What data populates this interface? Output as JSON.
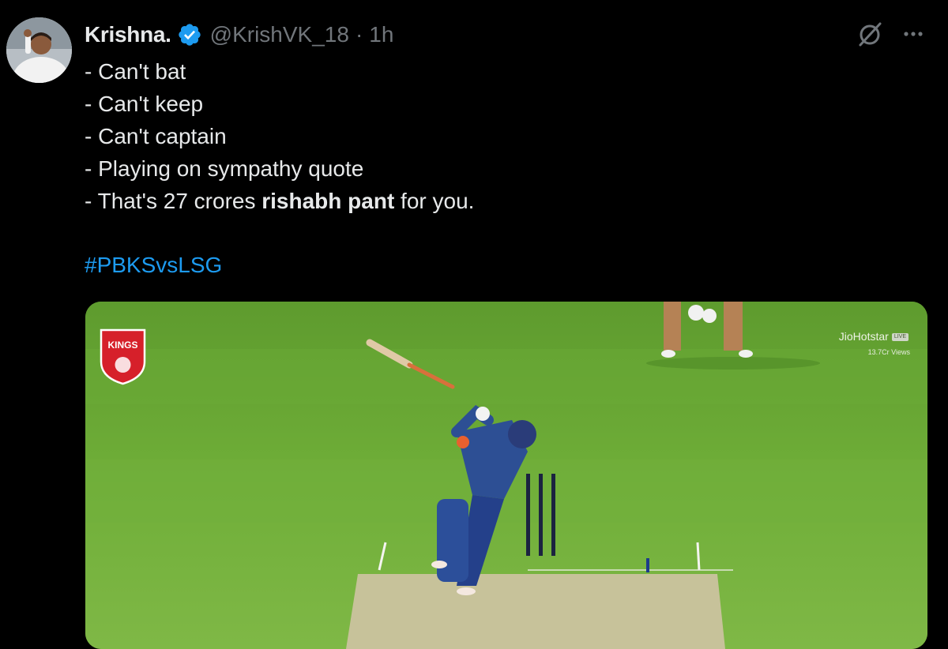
{
  "tweet": {
    "author": {
      "name": "Krishna.",
      "handle": "@KrishVK_18",
      "separator": "·",
      "time": "1h",
      "avatar_alt": "avatar"
    },
    "lines": [
      "- Can't bat",
      "- Can't keep",
      "- Can't captain",
      "- Playing on sympathy quote"
    ],
    "last_line": {
      "prefix": "- That's 27 crores ",
      "bold": "rishabh pant",
      "suffix": " for you."
    },
    "hashtag": "#PBKSvsLSG"
  },
  "media": {
    "logo_text": "KINGS",
    "watermark": "JioHotstar",
    "live_badge": "LIVE",
    "views": "13.7Cr Views"
  },
  "colors": {
    "background": "#000000",
    "text": "#e7e9ea",
    "muted": "#71767b",
    "link": "#1d9bf0",
    "verified": "#1d9bf0",
    "pitch_green": "#69a836"
  },
  "icons": {
    "verified": "verified-badge-icon",
    "grok": "grok-icon",
    "more": "more-options-icon"
  }
}
